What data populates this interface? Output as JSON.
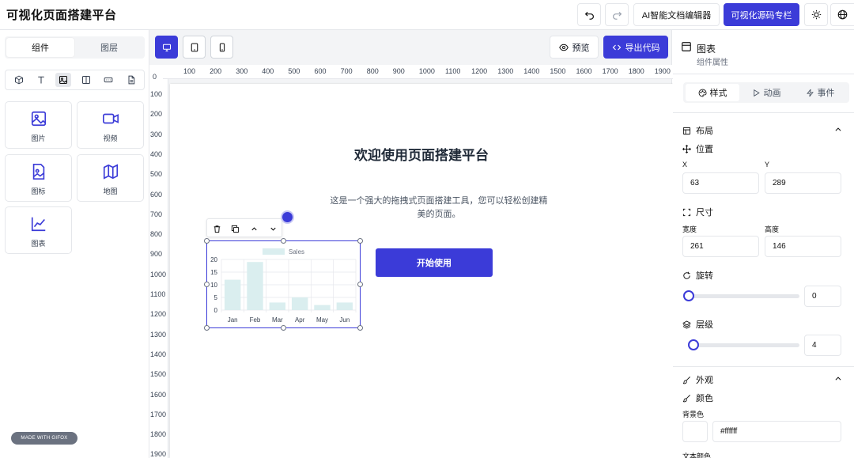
{
  "header": {
    "title": "可视化页面搭建平台",
    "undo_icon": "undo-icon",
    "redo_icon": "redo-icon",
    "ai_editor_label": "AI智能文档编辑器",
    "source_column_label": "可视化源码专栏",
    "theme_icon": "sun-icon",
    "lang_icon": "globe-icon"
  },
  "left_panel": {
    "tabs": [
      {
        "label": "组件",
        "active": true
      },
      {
        "label": "图层",
        "active": false
      }
    ],
    "categories": [
      {
        "icon": "cube-icon"
      },
      {
        "icon": "text-icon"
      },
      {
        "icon": "image-icon",
        "active": true
      },
      {
        "icon": "layout-icon"
      },
      {
        "icon": "input-icon"
      },
      {
        "icon": "file-icon"
      }
    ],
    "components": [
      {
        "label": "图片",
        "icon": "image-icon"
      },
      {
        "label": "视频",
        "icon": "video-icon"
      },
      {
        "label": "图标",
        "icon": "image-file-icon"
      },
      {
        "label": "地图",
        "icon": "map-icon"
      },
      {
        "label": "图表",
        "icon": "chart-line-icon"
      }
    ],
    "badge": "MADE WITH GIFOX"
  },
  "toolbar": {
    "devices": [
      {
        "icon": "desktop-icon",
        "active": true
      },
      {
        "icon": "tablet-icon",
        "active": false
      },
      {
        "icon": "mobile-icon",
        "active": false
      }
    ],
    "preview_label": "预览",
    "export_label": "导出代码"
  },
  "rulers": {
    "horizontal": [
      "100",
      "200",
      "300",
      "400",
      "500",
      "600",
      "700",
      "800",
      "900",
      "1000",
      "1100",
      "1200",
      "1300",
      "1400",
      "1500",
      "1600",
      "1700",
      "1800",
      "1900"
    ],
    "vertical_top": "0",
    "vertical": [
      "100",
      "200",
      "300",
      "400",
      "500",
      "600",
      "700",
      "800",
      "900",
      "1000",
      "1100",
      "1200",
      "1300",
      "1400",
      "1500",
      "1600",
      "1700",
      "1800",
      "1900"
    ]
  },
  "canvas": {
    "welcome": "欢迎使用页面搭建平台",
    "desc_line1": "这是一个强大的拖拽式页面搭建工具，您可以轻松创建精",
    "desc_line2": "美的页面。",
    "start_button": "开始使用"
  },
  "chart_data": {
    "type": "bar",
    "categories": [
      "Jan",
      "Feb",
      "Mar",
      "Apr",
      "May",
      "Jun"
    ],
    "series": [
      {
        "name": "Sales",
        "values": [
          12,
          19,
          3,
          5,
          2,
          3
        ]
      }
    ],
    "ylim": [
      0,
      20
    ],
    "yticks": [
      "0",
      "5",
      "10",
      "15",
      "20"
    ],
    "legend_position": "top",
    "grid": true,
    "bar_color": "#daeeef"
  },
  "right_panel": {
    "title": "图表",
    "subtitle": "组件属性",
    "tabs": [
      {
        "label": "样式",
        "icon": "palette-icon",
        "active": true
      },
      {
        "label": "动画",
        "icon": "play-icon",
        "active": false
      },
      {
        "label": "事件",
        "icon": "bolt-icon",
        "active": false
      }
    ],
    "layout_section": "布局",
    "position_label": "位置",
    "x_label": "X",
    "y_label": "Y",
    "x_value": "63",
    "y_value": "289",
    "size_label": "尺寸",
    "width_label": "宽度",
    "height_label": "高度",
    "width_value": "261",
    "height_value": "146",
    "rotation_label": "旋转",
    "rotation_value": "0",
    "rotation_fraction": 0,
    "zindex_label": "层级",
    "zindex_value": "4",
    "zindex_fraction": 0.04,
    "appearance_section": "外观",
    "color_label": "颜色",
    "bg_color_label": "背景色",
    "bg_color_value": "#ffffff",
    "text_color_label": "文本颜色"
  },
  "colors": {
    "primary": "#3b3bd8",
    "border": "#e5e7eb",
    "canvas_bg": "#f3f4f6"
  }
}
